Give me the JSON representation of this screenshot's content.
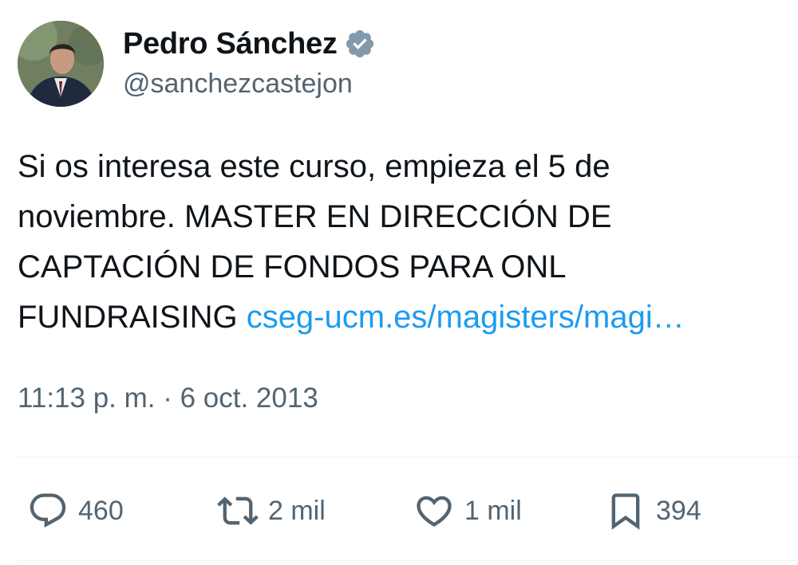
{
  "author": {
    "display_name": "Pedro Sánchez",
    "handle": "@sanchezcastejon",
    "verified": true
  },
  "tweet": {
    "lines": [
      "Si os interesa este curso, empieza el 5 de",
      "noviembre. MASTER EN DIRECCIÓN DE",
      "CAPTACIÓN DE FONDOS PARA ONL"
    ],
    "last_line_text": "FUNDRAISING ",
    "link_text": "cseg-ucm.es/magisters/magi…"
  },
  "meta": {
    "timestamp": "11:13 p. m. · 6 oct. 2013"
  },
  "actions": {
    "replies": "460",
    "retweets": "2 mil",
    "likes": "1 mil",
    "bookmarks": "394"
  },
  "colors": {
    "link": "#1d9bf0",
    "secondary_text": "#536471",
    "verified_badge": "#829aab"
  },
  "icons": {
    "verified": "verified-badge-icon",
    "reply": "reply-icon",
    "retweet": "retweet-icon",
    "like": "heart-icon",
    "bookmark": "bookmark-icon"
  }
}
